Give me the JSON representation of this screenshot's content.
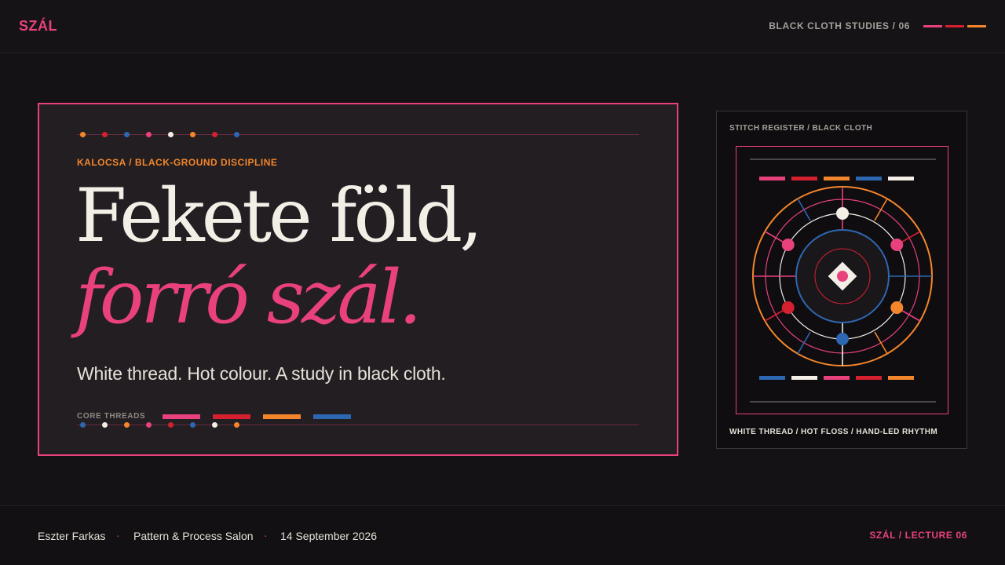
{
  "header": {
    "brand": "SZÁL",
    "series": "BLACK CLOTH STUDIES / 06"
  },
  "colors": {
    "pink": "#e8417e",
    "red": "#d4202f",
    "orange": "#f3862a",
    "blue": "#2e67b1",
    "white": "#f3eee6",
    "background": "#141215",
    "card": "#221e22"
  },
  "hero": {
    "kicker": "KALOCSA / BLACK-GROUND DISCIPLINE",
    "title_line1": "Fekete föld,",
    "title_line2": "forró szál.",
    "subtitle": "White thread. Hot colour. A study in black cloth.",
    "threads_label": "CORE THREADS",
    "top_dots": [
      "orange",
      "red",
      "blue",
      "pink",
      "white",
      "orange",
      "red",
      "blue"
    ],
    "bottom_dots": [
      "blue",
      "white",
      "orange",
      "pink",
      "red",
      "blue",
      "white",
      "orange"
    ],
    "core_threads": [
      "pink",
      "red",
      "orange",
      "blue"
    ]
  },
  "register": {
    "title": "STITCH REGISTER / BLACK CLOTH",
    "caption": "WHITE THREAD / HOT FLOSS / HAND-LED RHYTHM",
    "top_bars": [
      "pink",
      "red",
      "orange",
      "blue",
      "white"
    ],
    "bottom_bars": [
      "blue",
      "white",
      "pink",
      "red",
      "orange"
    ]
  },
  "footer": {
    "author": "Eszter Farkas",
    "event": "Pattern & Process Salon",
    "date": "14 September 2026",
    "separator": "·",
    "right": "SZÁL / LECTURE 06"
  }
}
